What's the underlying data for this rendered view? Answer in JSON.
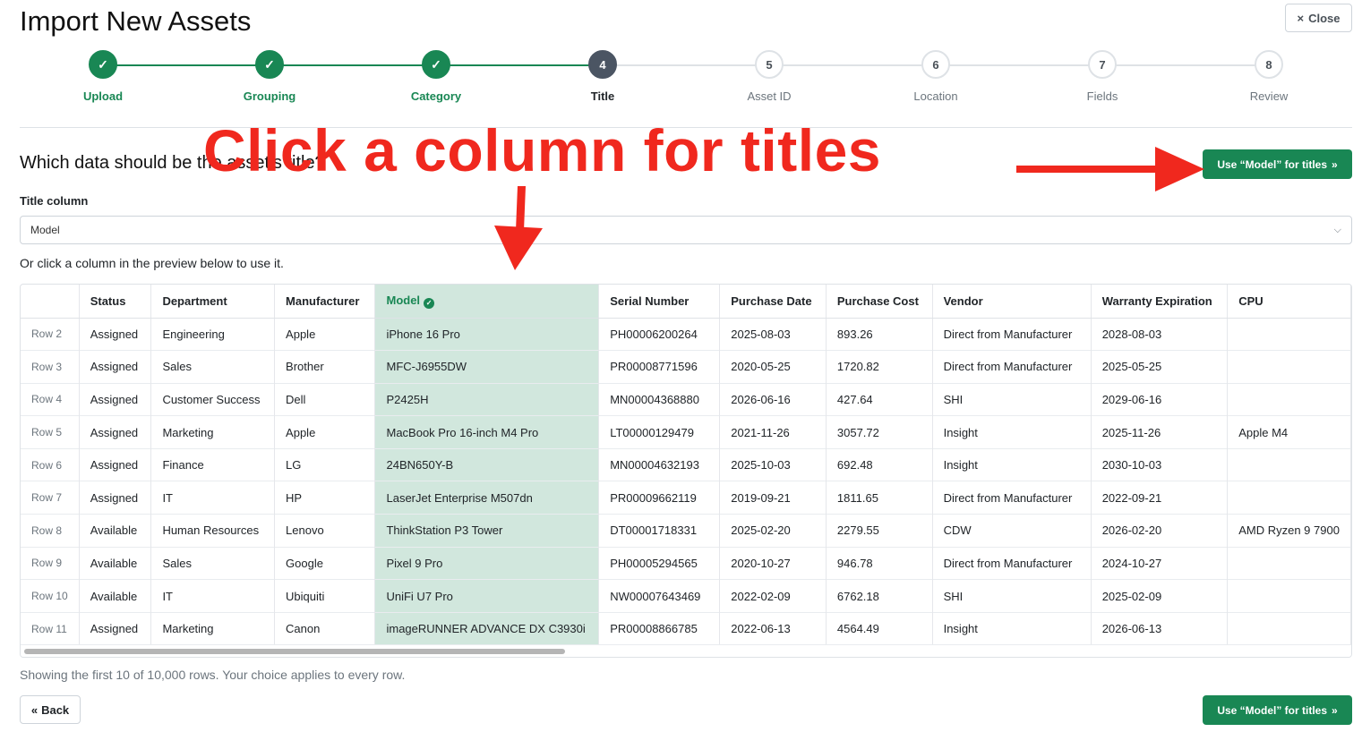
{
  "header": {
    "title": "Import New Assets",
    "close_label": "Close",
    "close_icon": "×"
  },
  "stepper": {
    "steps": [
      {
        "label": "Upload",
        "state": "done",
        "number": "✓"
      },
      {
        "label": "Grouping",
        "state": "done",
        "number": "✓"
      },
      {
        "label": "Category",
        "state": "done",
        "number": "✓"
      },
      {
        "label": "Title",
        "state": "current",
        "number": "4"
      },
      {
        "label": "Asset ID",
        "state": "pending",
        "number": "5"
      },
      {
        "label": "Location",
        "state": "pending",
        "number": "6"
      },
      {
        "label": "Fields",
        "state": "pending",
        "number": "7"
      },
      {
        "label": "Review",
        "state": "pending",
        "number": "8"
      }
    ]
  },
  "main": {
    "question": "Which data should be the asset's title?",
    "use_button_label": "Use “Model” for titles",
    "use_button_chevron": "»",
    "field_label": "Title column",
    "selected_value": "Model",
    "select_chevron": "⌵",
    "hint": "Or click a column in the preview below to use it."
  },
  "table": {
    "headers": [
      "",
      "Status",
      "Department",
      "Manufacturer",
      "Model",
      "Serial Number",
      "Purchase Date",
      "Purchase Cost",
      "Vendor",
      "Warranty Expiration",
      "CPU"
    ],
    "rows": [
      [
        "Row 2",
        "Assigned",
        "Engineering",
        "Apple",
        "iPhone 16 Pro",
        "PH00006200264",
        "2025-08-03",
        "893.26",
        "Direct from Manufacturer",
        "2028-08-03",
        ""
      ],
      [
        "Row 3",
        "Assigned",
        "Sales",
        "Brother",
        "MFC-J6955DW",
        "PR00008771596",
        "2020-05-25",
        "1720.82",
        "Direct from Manufacturer",
        "2025-05-25",
        ""
      ],
      [
        "Row 4",
        "Assigned",
        "Customer Success",
        "Dell",
        "P2425H",
        "MN00004368880",
        "2026-06-16",
        "427.64",
        "SHI",
        "2029-06-16",
        ""
      ],
      [
        "Row 5",
        "Assigned",
        "Marketing",
        "Apple",
        "MacBook Pro 16-inch M4 Pro",
        "LT00000129479",
        "2021-11-26",
        "3057.72",
        "Insight",
        "2025-11-26",
        "Apple M4"
      ],
      [
        "Row 6",
        "Assigned",
        "Finance",
        "LG",
        "24BN650Y-B",
        "MN00004632193",
        "2025-10-03",
        "692.48",
        "Insight",
        "2030-10-03",
        ""
      ],
      [
        "Row 7",
        "Assigned",
        "IT",
        "HP",
        "LaserJet Enterprise M507dn",
        "PR00009662119",
        "2019-09-21",
        "1811.65",
        "Direct from Manufacturer",
        "2022-09-21",
        ""
      ],
      [
        "Row 8",
        "Available",
        "Human Resources",
        "Lenovo",
        "ThinkStation P3 Tower",
        "DT00001718331",
        "2025-02-20",
        "2279.55",
        "CDW",
        "2026-02-20",
        "AMD Ryzen 9 7900"
      ],
      [
        "Row 9",
        "Available",
        "Sales",
        "Google",
        "Pixel 9 Pro",
        "PH00005294565",
        "2020-10-27",
        "946.78",
        "Direct from Manufacturer",
        "2024-10-27",
        ""
      ],
      [
        "Row 10",
        "Available",
        "IT",
        "Ubiquiti",
        "UniFi U7 Pro",
        "NW00007643469",
        "2022-02-09",
        "6762.18",
        "SHI",
        "2025-02-09",
        ""
      ],
      [
        "Row 11",
        "Assigned",
        "Marketing",
        "Canon",
        "imageRUNNER ADVANCE DX C3930i",
        "PR00008866785",
        "2022-06-13",
        "4564.49",
        "Insight",
        "2026-06-13",
        ""
      ]
    ]
  },
  "footer": {
    "note": "Showing the first 10 of 10,000 rows. Your choice applies to every row.",
    "back_label": "Back",
    "back_chevron": "«"
  },
  "annotation": {
    "text": "Click a column for titles",
    "color": "#f0281e"
  },
  "colors": {
    "success": "#198754",
    "current_step": "#4b5563",
    "highlight": "#d1e7dd"
  }
}
